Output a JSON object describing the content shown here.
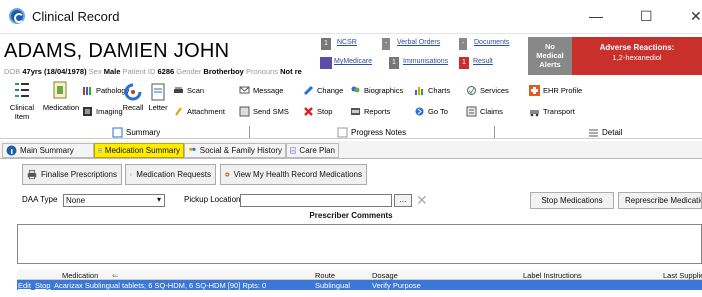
{
  "window": {
    "title": "Clinical Record",
    "minimize": "—",
    "maximize": "☐",
    "close": "✕"
  },
  "patient": {
    "name": "ADAMS, DAMIEN JOHN",
    "dob_label": "DOB",
    "dob": "47yrs (18/04/1978)",
    "sex_label": "Sex",
    "sex": "Male",
    "pid_label": "Patient ID",
    "pid": "6286",
    "gender_label": "Gender",
    "gender": "Brotherboy",
    "pronouns_label": "Pronouns",
    "pronouns": "Not re"
  },
  "indicators": {
    "ncsr": {
      "count": "1",
      "label": "NCSR"
    },
    "verbal": {
      "count": "-",
      "label": "Verbal Orders"
    },
    "documents": {
      "count": "-",
      "label": "Documents"
    },
    "mymedicare": {
      "label": "MyMedicare"
    },
    "immunisations": {
      "count": "1",
      "label": "Immunisations"
    },
    "result": {
      "count": "1",
      "label": "Result"
    }
  },
  "alerts": {
    "line1": "No",
    "line2": "Medical",
    "line3": "Alerts"
  },
  "adverse": {
    "title": "Adverse Reactions:",
    "value": "1,2-hexanediol"
  },
  "toolbar": {
    "clinical_item": "Clinical Item",
    "medication": "Medication",
    "pathology": "Pathology",
    "imaging": "Imaging",
    "recall": "Recall",
    "letter": "Letter",
    "scan": "Scan",
    "attachment": "Attachment",
    "message": "Message",
    "send_sms": "Send SMS",
    "change": "Change",
    "stop": "Stop",
    "biographics": "Biographics",
    "reports": "Reports",
    "charts": "Charts",
    "goto": "Go To",
    "services": "Services",
    "claims": "Claims",
    "ehr_profile": "EHR Profile",
    "transport": "Transport"
  },
  "tabs": {
    "summary": "Summary",
    "progress": "Progress Notes",
    "detail": "Detail"
  },
  "subtabs": {
    "main": "Main Summary",
    "medication": "Medication Summary",
    "social": "Social & Family History",
    "care": "Care Plan"
  },
  "actions": {
    "finalise": "Finalise Prescriptions",
    "requests": "Medication Requests",
    "myhealth": "View My Health Record Medications"
  },
  "filters": {
    "daa_label": "DAA Type",
    "daa_value": "None",
    "pickup_label": "Pickup Location",
    "pickup_value": "",
    "ellipsis": "..."
  },
  "buttons": {
    "stop_meds": "Stop Medications",
    "represcribe": "Represcribe Medication"
  },
  "comments_title": "Prescriber Comments",
  "grid": {
    "columns": {
      "medication": "Medication",
      "route": "Route",
      "dosage": "Dosage",
      "label": "Label Instructions",
      "last": "Last Supplied"
    },
    "rows": [
      {
        "edit": "Edit",
        "stop": "Stop",
        "medication": "Acarizax Sublingual tablets; 6 SQ-HDM, 6 SQ-HDM [90] Rpts: 0",
        "route": "Sublingual",
        "dosage": "Verify Purpose",
        "label": "",
        "last": ""
      }
    ]
  },
  "colors": {
    "adverse": "#c9302c",
    "alerts": "#888888",
    "active_tab": "#ffec00",
    "selected_row": "#3b78d6"
  }
}
